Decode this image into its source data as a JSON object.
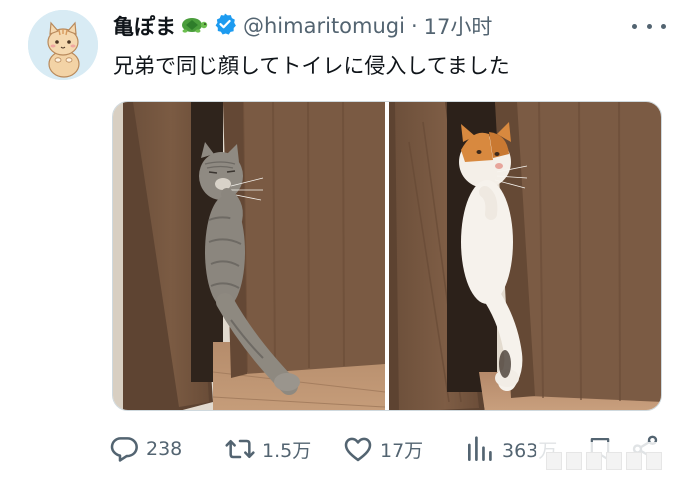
{
  "author": {
    "display_name": "亀ぽま",
    "handle": "@himaritomugi",
    "separator": "·",
    "time": "17小时"
  },
  "tweet": {
    "text": "兄弟で同じ顔してトイレに侵入してました"
  },
  "icons": {
    "avatar": "cartoon-cat-avatar",
    "name_emoji": "turtle-icon",
    "badge": "verified-badge-icon",
    "more": "more-dots-icon",
    "reply": "reply-bubble-icon",
    "retweet": "retweet-icon",
    "like": "heart-icon",
    "views": "views-bar-chart-icon",
    "bookmark": "bookmark-icon",
    "share": "share-icon"
  },
  "stats": {
    "replies": "238",
    "retweets": "1.5万",
    "likes": "17万",
    "views": "363万"
  },
  "colors": {
    "text": "#0f1419",
    "secondary": "#536471",
    "verified": "#1d9bf0",
    "avatar_bg": "#d7eaf3"
  }
}
